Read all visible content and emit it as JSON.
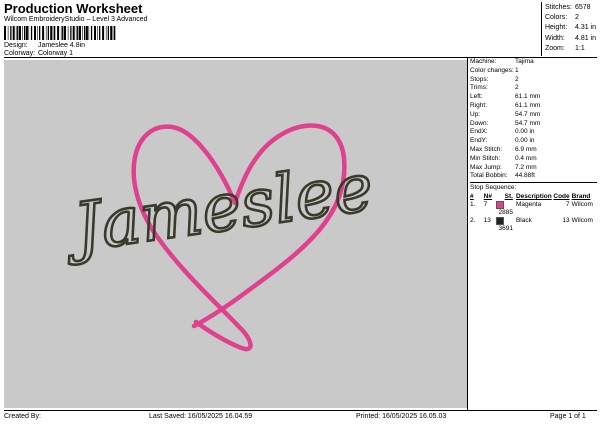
{
  "header": {
    "title": "Production Worksheet",
    "subtitle": "Wilcom EmbroideryStudio – Level 3 Advanced",
    "design_label": "Design:",
    "design_value": "Jameslee 4.8in",
    "colorway_label": "Colorway:",
    "colorway_value": "Colorway 1"
  },
  "top_stats": [
    {
      "label": "Stitches:",
      "value": "6578"
    },
    {
      "label": "Colors:",
      "value": "2"
    },
    {
      "label": "Height:",
      "value": "4.31 in"
    },
    {
      "label": "Width:",
      "value": "4.81 in"
    },
    {
      "label": "Zoom:",
      "value": "1:1"
    }
  ],
  "design": {
    "text": "Jameslee",
    "canvas_color": "#c9c9c9",
    "heart_color": "#e0418f",
    "text_color": "#3a3a2a"
  },
  "machine_info": [
    {
      "label": "Machine:",
      "value": "Tajima"
    },
    {
      "label": "Color changes:",
      "value": "1"
    },
    {
      "label": "Stops:",
      "value": "2"
    },
    {
      "label": "Trims:",
      "value": "2"
    },
    {
      "label": "Left:",
      "value": "61.1 mm"
    },
    {
      "label": "Right:",
      "value": "61.1 mm"
    },
    {
      "label": "Up:",
      "value": "54.7 mm"
    },
    {
      "label": "Down:",
      "value": "54.7 mm"
    },
    {
      "label": "EndX:",
      "value": "0.00 in"
    },
    {
      "label": "EndY:",
      "value": "0.00 in"
    },
    {
      "label": "Max Stitch:",
      "value": "6.9 mm"
    },
    {
      "label": "Min Stitch:",
      "value": "0.4 mm"
    },
    {
      "label": "Max Jump:",
      "value": "7.2 mm"
    },
    {
      "label": "Total Bobbin:",
      "value": "44.88ft"
    }
  ],
  "stop_sequence": {
    "title": "Stop Sequence:",
    "headers": {
      "num": "#",
      "n": "N#",
      "st": "St.",
      "desc": "Description",
      "code": "Code",
      "brand": "Brand"
    },
    "rows": [
      {
        "num": "1.",
        "n": "7",
        "swatch": "#e0418f",
        "st": "2885",
        "desc": "Magenta",
        "code": "7",
        "brand": "Wilcom"
      },
      {
        "num": "2.",
        "n": "13",
        "swatch": "#222222",
        "st": "3691",
        "desc": "Black",
        "code": "13",
        "brand": "Wilcom"
      }
    ]
  },
  "footer": {
    "created_by": "Created By:",
    "last_saved": "Last Saved: 16/05/2025 16.04.59",
    "printed": "Printed: 16/05/2025 16.05.03",
    "page": "Page 1 of 1"
  }
}
